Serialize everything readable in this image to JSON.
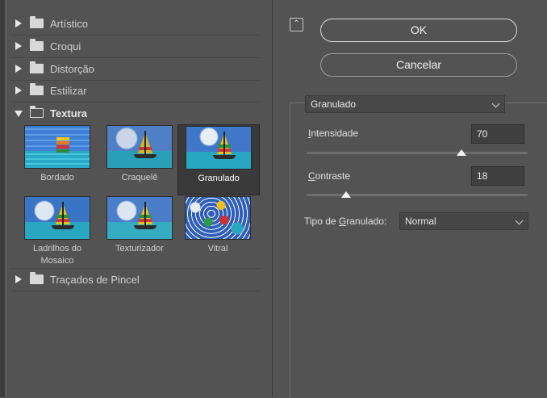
{
  "gallery": {
    "categories": [
      {
        "label": "Artístico"
      },
      {
        "label": "Croqui"
      },
      {
        "label": "Distorção"
      },
      {
        "label": "Estilizar"
      },
      {
        "label": "Textura"
      },
      {
        "label": "Traçados de Pincel"
      }
    ],
    "textura_filters": [
      {
        "label": "Bordado"
      },
      {
        "label": "Craquelê"
      },
      {
        "label": "Granulado"
      },
      {
        "label": "Ladrilhos do Mosaico"
      },
      {
        "label": "Texturizador"
      },
      {
        "label": "Vitral"
      }
    ],
    "selected_filter": "Granulado"
  },
  "buttons": {
    "ok": "OK",
    "cancel": "Cancelar"
  },
  "settings": {
    "filter_select_value": "Granulado",
    "intensity": {
      "label_underline": "I",
      "label_rest": "ntensidade",
      "value": "70",
      "fraction": 0.7
    },
    "contrast": {
      "label_underline": "C",
      "label_rest": "ontraste",
      "value": "18",
      "fraction": 0.18
    },
    "grain_type": {
      "label_prefix": "Tipo de ",
      "label_underline": "G",
      "label_rest": "ranulado:",
      "value": "Normal"
    }
  },
  "colors": {
    "panel_bg": "#535353",
    "selected_bg": "#3a3a3a",
    "text": "#dcdcdc"
  },
  "icons": {
    "expand": "collapse-arrows-icon",
    "category": "folder-icon",
    "disclosure": "triangle-icon"
  }
}
